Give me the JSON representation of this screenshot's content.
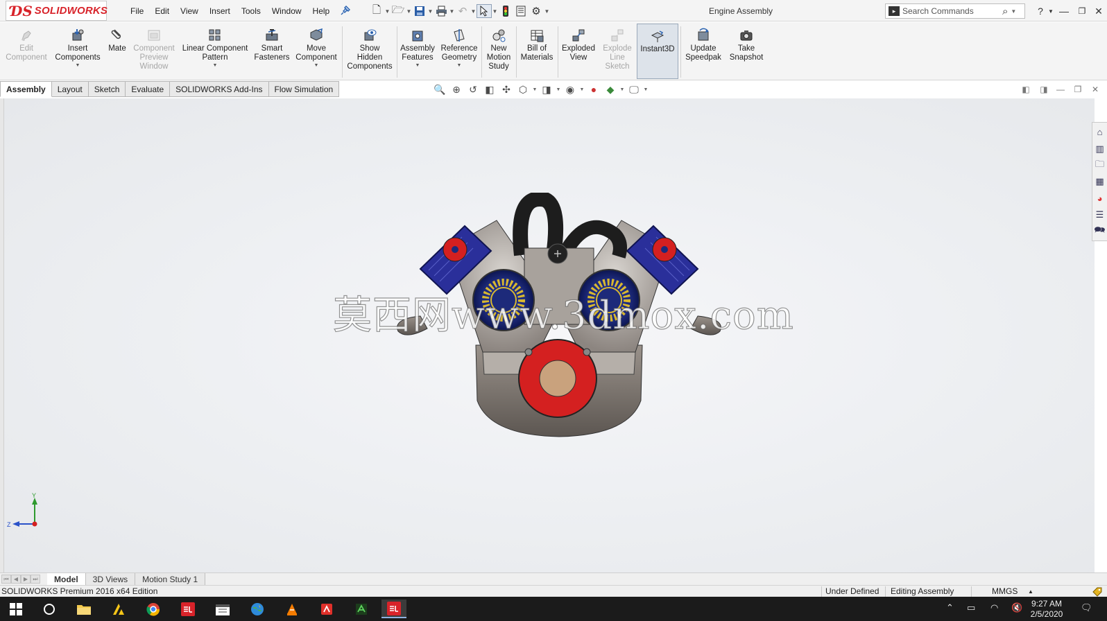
{
  "app": {
    "logo_text": "SOLIDWORKS",
    "document_title": "Engine Assembly",
    "brand_color": "#d8232a"
  },
  "menu": [
    "File",
    "Edit",
    "View",
    "Insert",
    "Tools",
    "Window",
    "Help"
  ],
  "search": {
    "placeholder": "Search Commands"
  },
  "commands": [
    {
      "label": "Edit\nComponent",
      "icon": "edit-component-icon",
      "enabled": false
    },
    {
      "label": "Insert\nComponents",
      "icon": "insert-components-icon",
      "enabled": true,
      "dropdown": true
    },
    {
      "label": "Mate",
      "icon": "mate-icon",
      "enabled": true
    },
    {
      "label": "Component\nPreview\nWindow",
      "icon": "component-preview-icon",
      "enabled": false
    },
    {
      "label": "Linear Component\nPattern",
      "icon": "linear-pattern-icon",
      "enabled": true,
      "dropdown": true
    },
    {
      "label": "Smart\nFasteners",
      "icon": "smart-fasteners-icon",
      "enabled": true
    },
    {
      "label": "Move\nComponent",
      "icon": "move-component-icon",
      "enabled": true,
      "dropdown": true
    },
    {
      "label": "Show\nHidden\nComponents",
      "icon": "show-hidden-icon",
      "enabled": true
    },
    {
      "label": "Assembly\nFeatures",
      "icon": "assembly-features-icon",
      "enabled": true,
      "dropdown": true
    },
    {
      "label": "Reference\nGeometry",
      "icon": "reference-geometry-icon",
      "enabled": true,
      "dropdown": true
    },
    {
      "label": "New\nMotion\nStudy",
      "icon": "motion-study-icon",
      "enabled": true
    },
    {
      "label": "Bill of\nMaterials",
      "icon": "bill-of-materials-icon",
      "enabled": true
    },
    {
      "label": "Exploded\nView",
      "icon": "exploded-view-icon",
      "enabled": true
    },
    {
      "label": "Explode\nLine\nSketch",
      "icon": "explode-line-icon",
      "enabled": false
    },
    {
      "label": "Instant3D",
      "icon": "instant3d-icon",
      "enabled": true,
      "active": true
    },
    {
      "label": "Update\nSpeedpak",
      "icon": "speedpak-icon",
      "enabled": true
    },
    {
      "label": "Take\nSnapshot",
      "icon": "camera-icon",
      "enabled": true
    }
  ],
  "tabs": [
    "Assembly",
    "Layout",
    "Sketch",
    "Evaluate",
    "SOLIDWORKS Add-Ins",
    "Flow Simulation"
  ],
  "active_tab": "Assembly",
  "watermark": "莫西网www.3dmox.com",
  "triad": {
    "y": "Y",
    "z": "Z"
  },
  "bottom_tabs": [
    "Model",
    "3D Views",
    "Motion Study 1"
  ],
  "status": {
    "edition": "SOLIDWORKS Premium 2016 x64 Edition",
    "definition": "Under Defined",
    "mode": "Editing Assembly",
    "units": "MMGS",
    "units_arrow": "▲"
  },
  "clock": {
    "time": "9:27 AM",
    "date": "2/5/2020"
  }
}
